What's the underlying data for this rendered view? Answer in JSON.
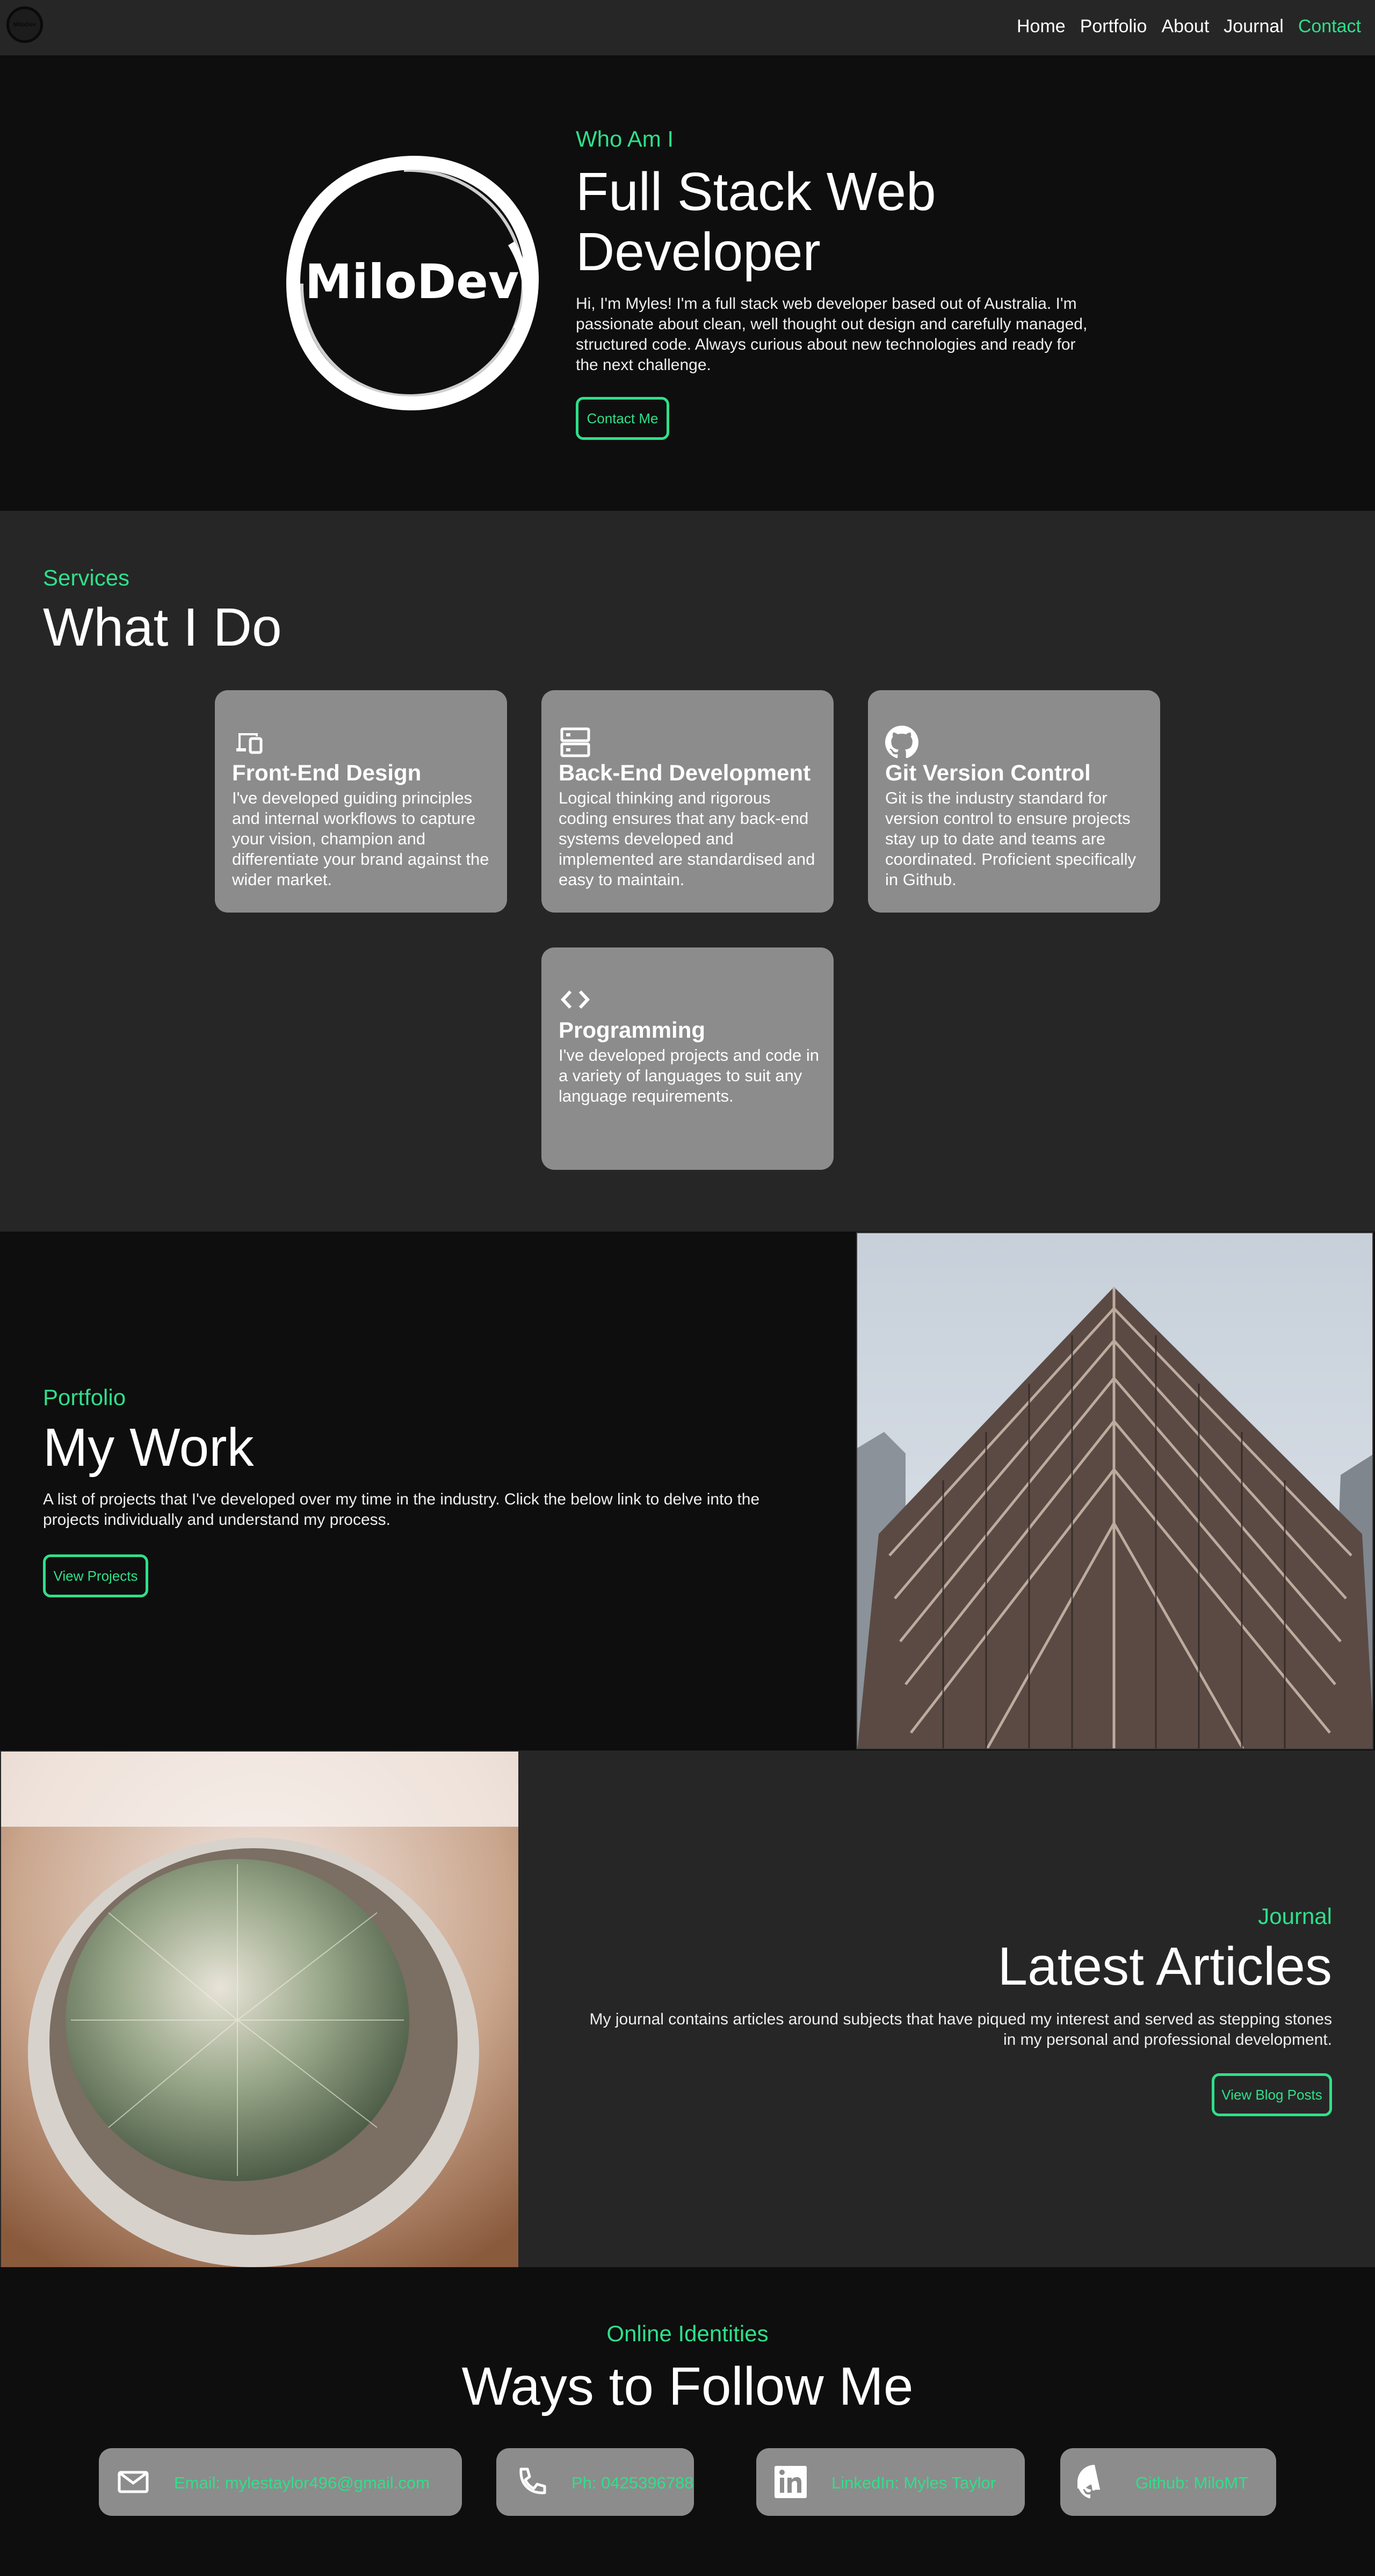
{
  "nav": {
    "logo_text": "MiloDev",
    "links": [
      "Home",
      "Portfolio",
      "About",
      "Journal",
      "Contact"
    ]
  },
  "hero": {
    "logo_text": "MiloDev",
    "eyebrow": "Who Am I",
    "title_line1": "Full Stack Web",
    "title_line2": "Developer",
    "description": "Hi, I'm Myles! I'm a full stack web developer based out of Australia. I'm passionate about clean, well thought out design and carefully managed, structured code. Always curious about new technologies and ready for the next challenge.",
    "button": "Contact Me"
  },
  "services": {
    "eyebrow": "Services",
    "title": "What I Do",
    "cards": [
      {
        "icon": "devices-icon",
        "title": "Front-End Design",
        "description": "I've developed guiding principles and internal workflows to capture your vision, champion and differentiate your brand against the wider market."
      },
      {
        "icon": "server-icon",
        "title": "Back-End Development",
        "description": "Logical thinking and rigorous coding ensures that any back-end systems developed and implemented are standardised and easy to maintain."
      },
      {
        "icon": "github-icon",
        "title": "Git Version Control",
        "description": "Git is the industry standard for version control to ensure projects stay up to date and teams are coordinated. Proficient specifically in Github."
      },
      {
        "icon": "code-icon",
        "title": "Programming",
        "description": "I've developed projects and code in a variety of languages to suit any language requirements."
      }
    ]
  },
  "portfolio": {
    "eyebrow": "Portfolio",
    "title": "My Work",
    "description": "A list of projects that I've developed over my time in the industry. Click the below link to delve into the projects individually and understand my process.",
    "button": "View Projects"
  },
  "journal": {
    "eyebrow": "Journal",
    "title": "Latest Articles",
    "description": "My journal contains articles around subjects that have piqued my interest and served as stepping stones in my personal and professional development.",
    "button": "View Blog Posts"
  },
  "contact": {
    "eyebrow": "Online Identities",
    "title": "Ways to Follow Me",
    "items": [
      {
        "icon": "mail-icon",
        "label": "Email: mylestaylor496@gmail.com"
      },
      {
        "icon": "phone-icon",
        "label": "Ph: 0425396788"
      },
      {
        "icon": "linkedin-icon",
        "label": "LinkedIn: Myles Taylor"
      },
      {
        "icon": "github-icon",
        "label": "Github: MiloMT"
      }
    ]
  },
  "colors": {
    "accent": "#2ee08a",
    "card": "#8c8c8c",
    "dark": "#0e0e0e",
    "panel": "#262626"
  }
}
